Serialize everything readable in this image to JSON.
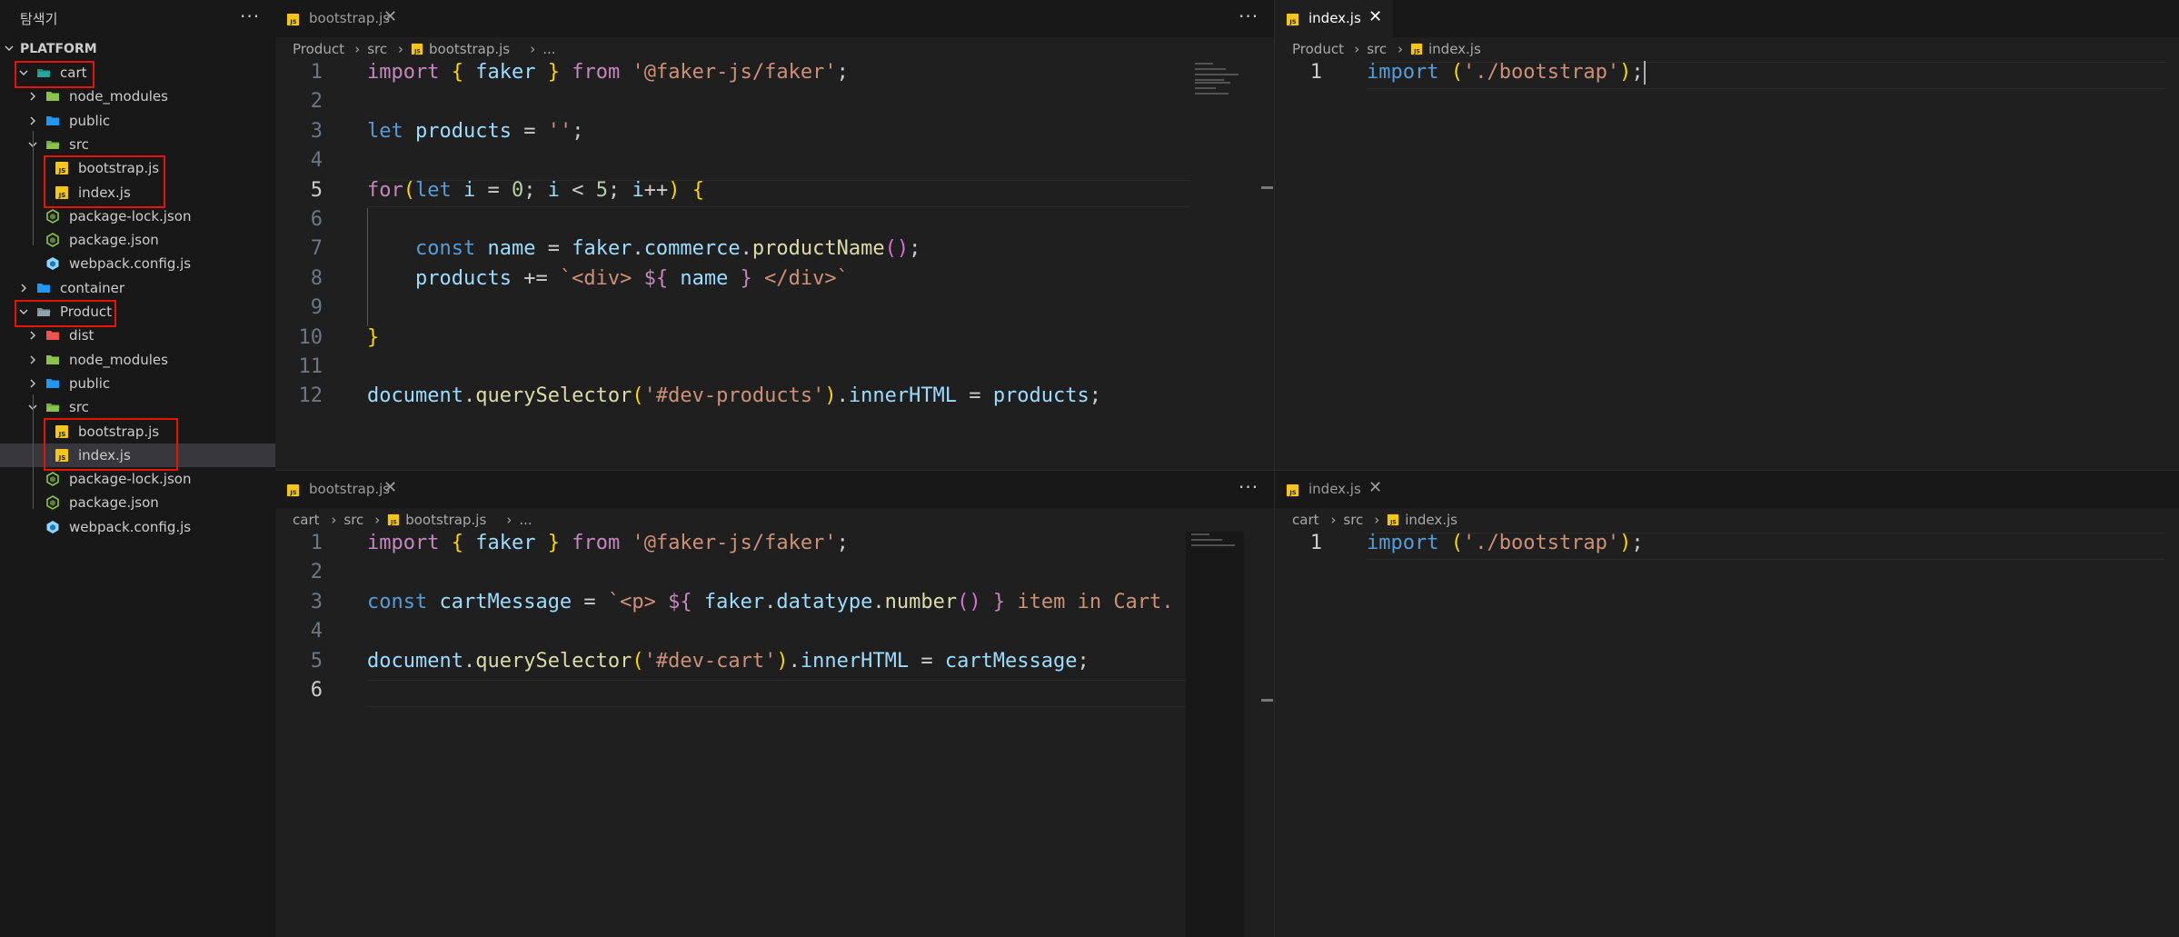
{
  "sidebar": {
    "title": "탐색기",
    "more": "···",
    "root": "PLATFORM",
    "items": [
      {
        "label": "cart",
        "type": "folder",
        "icon": "cart-folder-icon",
        "indent": 0,
        "open": true,
        "boxed": true
      },
      {
        "label": "node_modules",
        "type": "folder",
        "icon": "node-modules-folder-icon",
        "indent": 1,
        "open": false
      },
      {
        "label": "public",
        "type": "folder",
        "icon": "public-folder-icon",
        "indent": 1,
        "open": false
      },
      {
        "label": "src",
        "type": "folder",
        "icon": "src-folder-icon",
        "indent": 1,
        "open": true
      },
      {
        "label": "bootstrap.js",
        "type": "js",
        "icon": "js-file-icon",
        "indent": 2
      },
      {
        "label": "index.js",
        "type": "js",
        "icon": "js-file-icon",
        "indent": 2
      },
      {
        "label": "package-lock.json",
        "type": "json",
        "icon": "node-json-icon",
        "indent": 1
      },
      {
        "label": "package.json",
        "type": "json",
        "icon": "node-json-icon",
        "indent": 1
      },
      {
        "label": "webpack.config.js",
        "type": "webpack",
        "icon": "webpack-icon",
        "indent": 1
      },
      {
        "label": "container",
        "type": "folder",
        "icon": "container-folder-icon",
        "indent": 0,
        "open": false
      },
      {
        "label": "Product",
        "type": "folder",
        "icon": "product-folder-icon",
        "indent": 0,
        "open": true,
        "boxed": true
      },
      {
        "label": "dist",
        "type": "folder",
        "icon": "dist-folder-icon",
        "indent": 1,
        "open": false
      },
      {
        "label": "node_modules",
        "type": "folder",
        "icon": "node-modules-folder-icon",
        "indent": 1,
        "open": false
      },
      {
        "label": "public",
        "type": "folder",
        "icon": "public-folder-icon",
        "indent": 1,
        "open": false
      },
      {
        "label": "src",
        "type": "folder",
        "icon": "src-folder-icon",
        "indent": 1,
        "open": true
      },
      {
        "label": "bootstrap.js",
        "type": "js",
        "icon": "js-file-icon",
        "indent": 2
      },
      {
        "label": "index.js",
        "type": "js",
        "icon": "js-file-icon",
        "indent": 2,
        "selected": true
      },
      {
        "label": "package-lock.json",
        "type": "json",
        "icon": "node-json-icon",
        "indent": 1
      },
      {
        "label": "package.json",
        "type": "json",
        "icon": "node-json-icon",
        "indent": 1
      },
      {
        "label": "webpack.config.js",
        "type": "webpack",
        "icon": "webpack-icon",
        "indent": 1
      }
    ]
  },
  "editors": [
    {
      "tab_label": "bootstrap.js",
      "tab_active": false,
      "close": "✕",
      "more": "···",
      "breadcrumb": [
        "Product",
        "src",
        "bootstrap.js",
        "..."
      ],
      "current_line": 5,
      "lines": [
        [
          [
            "k",
            "import"
          ],
          [
            "p",
            " "
          ],
          [
            "y",
            "{"
          ],
          [
            "p",
            " "
          ],
          [
            "v",
            "faker"
          ],
          [
            "p",
            " "
          ],
          [
            "y",
            "}"
          ],
          [
            "p",
            " "
          ],
          [
            "k",
            "from"
          ],
          [
            "p",
            " "
          ],
          [
            "s",
            "'@faker-js/faker'"
          ],
          [
            "p",
            ";"
          ]
        ],
        [],
        [
          [
            "b",
            "let"
          ],
          [
            "p",
            " "
          ],
          [
            "v",
            "products"
          ],
          [
            "p",
            " = "
          ],
          [
            "s",
            "''"
          ],
          [
            "p",
            ";"
          ]
        ],
        [],
        [
          [
            "k",
            "for"
          ],
          [
            "y",
            "("
          ],
          [
            "b",
            "let"
          ],
          [
            "p",
            " "
          ],
          [
            "v",
            "i"
          ],
          [
            "p",
            " = "
          ],
          [
            "n",
            "0"
          ],
          [
            "p",
            "; "
          ],
          [
            "v",
            "i"
          ],
          [
            "p",
            " < "
          ],
          [
            "n",
            "5"
          ],
          [
            "p",
            "; "
          ],
          [
            "v",
            "i"
          ],
          [
            "p",
            "++"
          ],
          [
            "y",
            ")"
          ],
          [
            "p",
            " "
          ],
          [
            "y",
            "{"
          ]
        ],
        [],
        [
          [
            "p",
            "    "
          ],
          [
            "b",
            "const"
          ],
          [
            "p",
            " "
          ],
          [
            "v",
            "name"
          ],
          [
            "p",
            " = "
          ],
          [
            "v",
            "faker"
          ],
          [
            "p",
            "."
          ],
          [
            "v",
            "commerce"
          ],
          [
            "p",
            "."
          ],
          [
            "f",
            "productName"
          ],
          [
            "m",
            "()"
          ],
          [
            "p",
            ";"
          ]
        ],
        [
          [
            "p",
            "    "
          ],
          [
            "v",
            "products"
          ],
          [
            "p",
            " += "
          ],
          [
            "s",
            "`<div> "
          ],
          [
            "k",
            "${"
          ],
          [
            "p",
            " "
          ],
          [
            "v",
            "name"
          ],
          [
            "p",
            " "
          ],
          [
            "k",
            "}"
          ],
          [
            "s",
            " </div>`"
          ]
        ],
        [],
        [
          [
            "y",
            "}"
          ]
        ],
        [],
        [
          [
            "v",
            "document"
          ],
          [
            "p",
            "."
          ],
          [
            "f",
            "querySelector"
          ],
          [
            "y",
            "("
          ],
          [
            "s",
            "'#dev-products'"
          ],
          [
            "y",
            ")"
          ],
          [
            "p",
            "."
          ],
          [
            "v",
            "innerHTML"
          ],
          [
            "p",
            " = "
          ],
          [
            "v",
            "products"
          ],
          [
            "p",
            ";"
          ]
        ]
      ]
    },
    {
      "tab_label": "index.js",
      "tab_active": true,
      "close": "✕",
      "breadcrumb": [
        "Product",
        "src",
        "index.js"
      ],
      "current_line": 1,
      "lines": [
        [
          [
            "b",
            "import"
          ],
          [
            "p",
            " "
          ],
          [
            "y",
            "("
          ],
          [
            "s",
            "'./bootstrap'"
          ],
          [
            "y",
            ")"
          ],
          [
            "p",
            ";"
          ]
        ]
      ]
    },
    {
      "tab_label": "bootstrap.js",
      "tab_active": false,
      "close": "✕",
      "more": "···",
      "breadcrumb": [
        "cart",
        "src",
        "bootstrap.js",
        "..."
      ],
      "current_line": 6,
      "lines": [
        [
          [
            "k",
            "import"
          ],
          [
            "p",
            " "
          ],
          [
            "y",
            "{"
          ],
          [
            "p",
            " "
          ],
          [
            "v",
            "faker"
          ],
          [
            "p",
            " "
          ],
          [
            "y",
            "}"
          ],
          [
            "p",
            " "
          ],
          [
            "k",
            "from"
          ],
          [
            "p",
            " "
          ],
          [
            "s",
            "'@faker-js/faker'"
          ],
          [
            "p",
            ";"
          ]
        ],
        [],
        [
          [
            "b",
            "const"
          ],
          [
            "p",
            " "
          ],
          [
            "v",
            "cartMessage"
          ],
          [
            "p",
            " = "
          ],
          [
            "s",
            "`<p> "
          ],
          [
            "k",
            "${"
          ],
          [
            "p",
            " "
          ],
          [
            "v",
            "faker"
          ],
          [
            "p",
            "."
          ],
          [
            "v",
            "datatype"
          ],
          [
            "p",
            "."
          ],
          [
            "f",
            "number"
          ],
          [
            "m",
            "()"
          ],
          [
            "p",
            " "
          ],
          [
            "k",
            "}"
          ],
          [
            "s",
            " item in Cart."
          ]
        ],
        [],
        [
          [
            "v",
            "document"
          ],
          [
            "p",
            "."
          ],
          [
            "f",
            "querySelector"
          ],
          [
            "y",
            "("
          ],
          [
            "s",
            "'#dev-cart'"
          ],
          [
            "y",
            ")"
          ],
          [
            "p",
            "."
          ],
          [
            "v",
            "innerHTML"
          ],
          [
            "p",
            " = "
          ],
          [
            "v",
            "cartMessage"
          ],
          [
            "p",
            ";"
          ]
        ],
        []
      ]
    },
    {
      "tab_label": "index.js",
      "tab_active": false,
      "close": "✕",
      "breadcrumb": [
        "cart",
        "src",
        "index.js"
      ],
      "current_line": 1,
      "lines": [
        [
          [
            "b",
            "import"
          ],
          [
            "p",
            " "
          ],
          [
            "y",
            "("
          ],
          [
            "s",
            "'./bootstrap'"
          ],
          [
            "y",
            ")"
          ],
          [
            "p",
            ";"
          ]
        ]
      ]
    }
  ],
  "colors": {
    "js_icon": "#f5c518",
    "folder_green": "#8bc34a",
    "folder_blue": "#2196f3",
    "folder_teal": "#26a69a",
    "folder_red": "#ef5350",
    "highlight_box": "#e51400"
  }
}
